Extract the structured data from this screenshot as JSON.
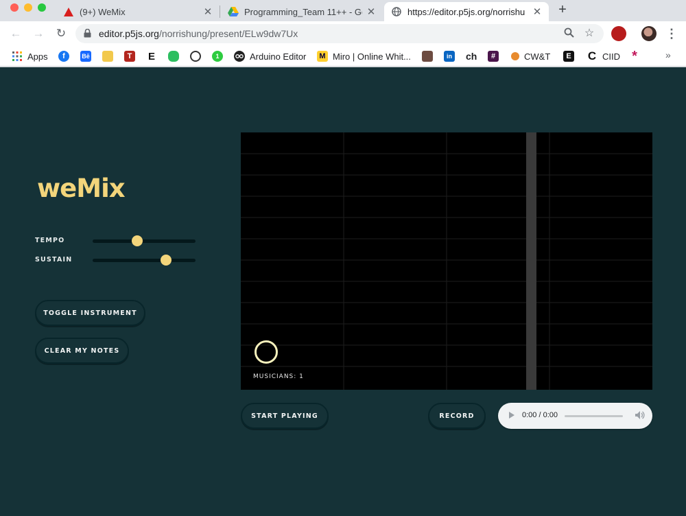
{
  "browser": {
    "tabs": [
      {
        "title": "(9+) WeMix",
        "icon": "warning-triangle-icon"
      },
      {
        "title": "Programming_Team 11++ - Goo",
        "icon": "google-drive-icon"
      },
      {
        "title": "https://editor.p5js.org/norrishu",
        "icon": "globe-icon"
      }
    ],
    "url_host": "editor.p5js.org",
    "url_path": "/norrishung/present/ELw9dw7Ux",
    "bookmarks": {
      "apps": "Apps",
      "arduino": "Arduino Editor",
      "miro": "Miro | Online Whit...",
      "ch": "ch",
      "cwt": "CW&T",
      "ciid": "CIID"
    },
    "bookmark_chevron": "»",
    "glyphs": {
      "back": "←",
      "forward": "→",
      "reload": "↻",
      "zoom": "🔍",
      "star": "☆",
      "new_tab": "+",
      "close": "✕",
      "menu": "⋮"
    }
  },
  "app": {
    "logo": "weMix",
    "tempo_label": "TEMPO",
    "tempo_value": 0.43,
    "sustain_label": "SUSTAIN",
    "sustain_value": 0.71,
    "toggle_label": "TOGGLE INSTRUMENT",
    "clear_label": "CLEAR MY NOTES",
    "musicians_label": "MUSICIANS: 1",
    "start_label": "START PLAYING",
    "record_label": "RECORD",
    "audio_time": "0:00 / 0:00",
    "colors": {
      "background": "#153237",
      "accent": "#f3d57b",
      "canvas": "#000000",
      "ring": "#f7f1bc"
    }
  }
}
